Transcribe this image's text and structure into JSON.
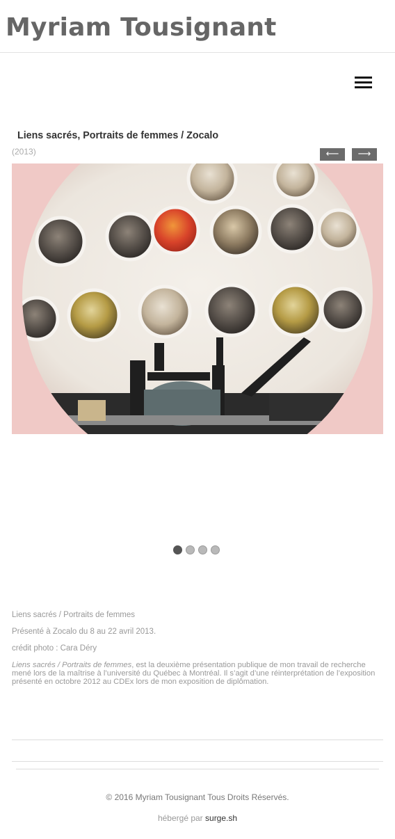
{
  "header": {
    "site_title": "Myriam Tousignant"
  },
  "nav": {
    "menu_icon": "hamburger-menu-icon"
  },
  "project": {
    "title": "Liens sacrés, Portraits de femmes / Zocalo",
    "year": "(2013)"
  },
  "slider": {
    "prev_label": "⟵",
    "next_label": "⟶",
    "slide_count": 4,
    "active_slide": 1,
    "image_subject": "circular portrait prints on wall behind a printing press"
  },
  "description": {
    "line1": "Liens sacrés / Portraits de femmes",
    "line2": "Présenté à Zocalo du 8 au 22 avril 2013.",
    "line3": "crédit photo : Cara Déry",
    "para_italic": "Liens sacrés / Portraits de femmes",
    "para_rest": ", est la deuxième présentation publique de mon travail de recherche mené lors de la maîtrise à l’université du Québec à Montréal. Il s’agit d’une réinterprétation de l’exposition présenté en octobre 2012 au CDEx lors de mon exposition de diplômation."
  },
  "footer": {
    "copyright": "© 2016 Myriam Tousignant Tous Droits Réservés.",
    "hosted_prefix": "hébergé par ",
    "hosted_link": "surge.sh"
  },
  "colors": {
    "title": "#666666",
    "arrow_bg": "#6b6b6b",
    "slide_bg": "#f0c9c6",
    "active_dot": "#555555"
  }
}
